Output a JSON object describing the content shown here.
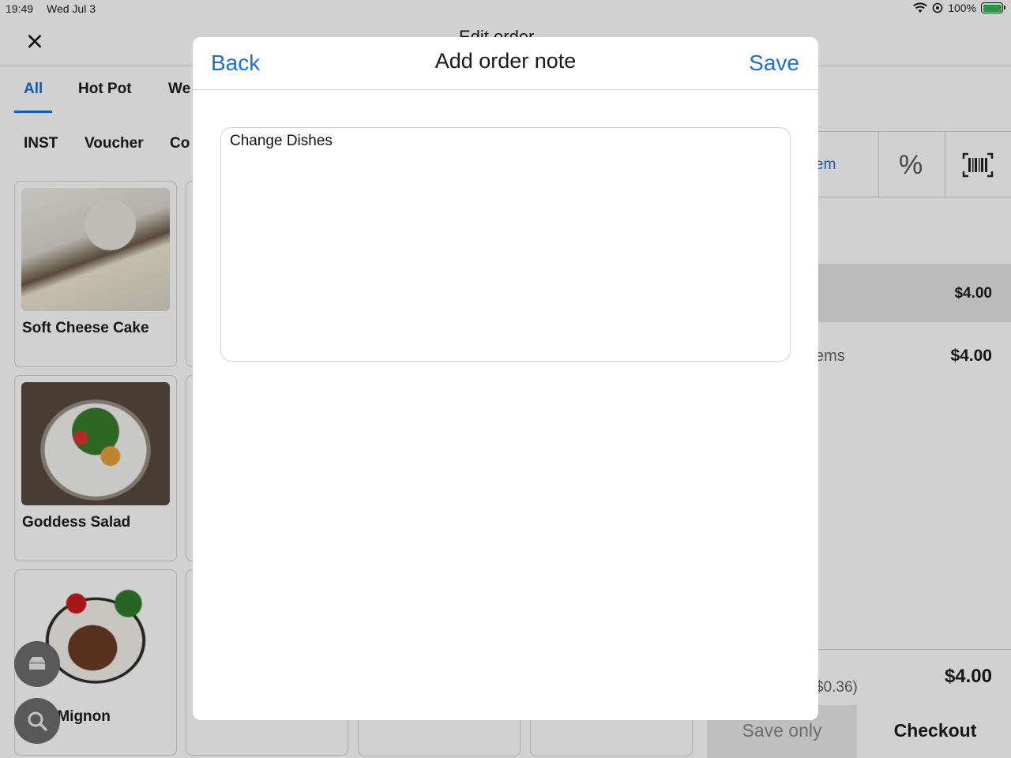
{
  "status_bar": {
    "time": "19:49",
    "date": "Wed Jul 3",
    "battery": "100%",
    "icons": [
      "wifi-icon",
      "location-icon",
      "battery-charging-icon"
    ]
  },
  "header": {
    "title": "Edit order"
  },
  "category_tabs": [
    "All",
    "Hot Pot",
    "We"
  ],
  "category_tabs_row2": [
    "INST",
    "Voucher",
    "Co"
  ],
  "products": [
    {
      "name": "Soft Cheese Cake"
    },
    {
      "name": "Goddess Salad"
    },
    {
      "name": "Filet Mignon"
    }
  ],
  "order_panel": {
    "add_item_partial": "em",
    "line_price": "$4.00",
    "items_label": "ems",
    "items_total": "$4.00",
    "tax_partial": "$0.36)",
    "total": "$4.00",
    "save_only": "Save only",
    "checkout": "Checkout"
  },
  "modal": {
    "back": "Back",
    "title": "Add order note",
    "save": "Save",
    "note_value": "Change Dishes"
  },
  "colors": {
    "accent": "#1d6fd6",
    "battery": "#2fb84b"
  }
}
